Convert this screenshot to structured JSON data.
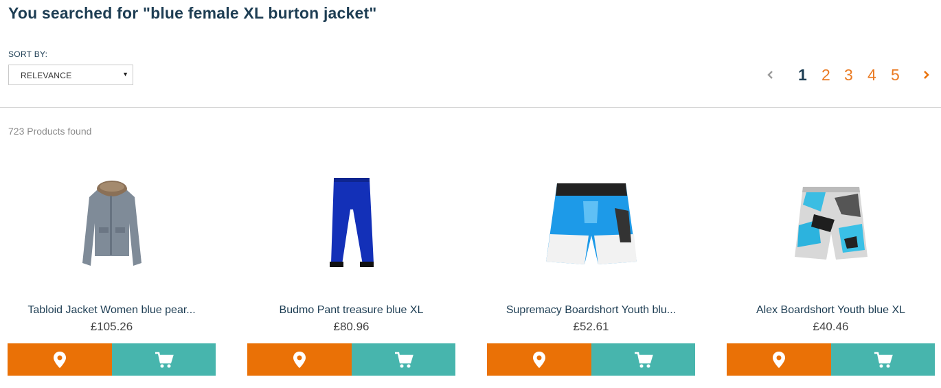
{
  "search": {
    "title": "You searched for \"blue female XL burton jacket\""
  },
  "sort": {
    "label": "SORT BY:",
    "selected": "RELEVANCE"
  },
  "pagination": {
    "prev_icon": "chevron-left-icon",
    "next_icon": "chevron-right-icon",
    "current_page": "1",
    "pages": [
      "1",
      "2",
      "3",
      "4",
      "5"
    ]
  },
  "results": {
    "count_text": "723 Products found"
  },
  "colors": {
    "heading": "#1d3d53",
    "accent_orange": "#ea7106",
    "accent_teal": "#47b5ad",
    "page_link": "#ea7a22"
  },
  "products": [
    {
      "name": "Tabloid Jacket Women blue pear...",
      "price": "£105.26",
      "image": "grey-jacket",
      "location_icon": "map-pin-icon",
      "cart_icon": "shopping-cart-icon"
    },
    {
      "name": "Budmo Pant treasure blue XL",
      "price": "£80.96",
      "image": "blue-pants",
      "location_icon": "map-pin-icon",
      "cart_icon": "shopping-cart-icon"
    },
    {
      "name": "Supremacy Boardshort Youth blu...",
      "price": "£52.61",
      "image": "blue-boardshort",
      "location_icon": "map-pin-icon",
      "cart_icon": "shopping-cart-icon"
    },
    {
      "name": "Alex Boardshort Youth blue XL",
      "price": "£40.46",
      "image": "patterned-boardshort",
      "location_icon": "map-pin-icon",
      "cart_icon": "shopping-cart-icon"
    }
  ]
}
